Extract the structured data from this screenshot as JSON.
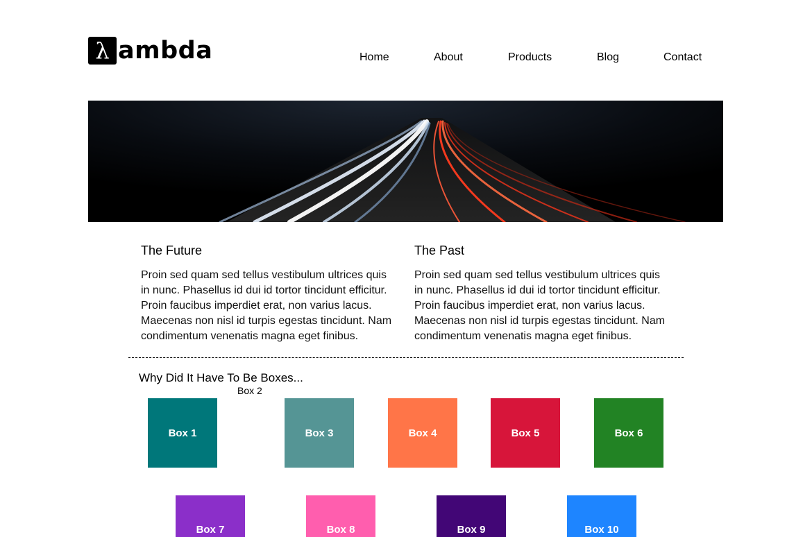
{
  "logo": {
    "mark": "λ",
    "text": "ambda"
  },
  "nav": {
    "items": [
      {
        "label": "Home"
      },
      {
        "label": "About"
      },
      {
        "label": "Products"
      },
      {
        "label": "Blog"
      },
      {
        "label": "Contact"
      }
    ]
  },
  "sections": [
    {
      "title": "The Future",
      "body": "Proin sed quam sed tellus vestibulum ultrices quis in nunc. Phasellus id dui id tortor tincidunt efficitur. Proin faucibus imperdiet erat, non varius lacus. Maecenas non nisl id turpis egestas tincidunt. Nam condimentum venenatis magna eget finibus."
    },
    {
      "title": "The Past",
      "body": "Proin sed quam sed tellus vestibulum ultrices quis in nunc. Phasellus id dui id tortor tincidunt efficitur. Proin faucibus imperdiet erat, non varius lacus. Maecenas non nisl id turpis egestas tincidunt. Nam condimentum venenatis magna eget finibus."
    }
  ],
  "boxes_title": "Why Did It Have To Be Boxes...",
  "boxes": [
    {
      "label": "Box 1",
      "color": "#00777a"
    },
    {
      "label": "Box 2",
      "color": "#ffffff"
    },
    {
      "label": "Box 3",
      "color": "#559595"
    },
    {
      "label": "Box 4",
      "color": "#ff7548"
    },
    {
      "label": "Box 5",
      "color": "#d7153a"
    },
    {
      "label": "Box 6",
      "color": "#228324"
    },
    {
      "label": "Box 7",
      "color": "#8b2fc9"
    },
    {
      "label": "Box 8",
      "color": "#ff5eae"
    },
    {
      "label": "Box 9",
      "color": "#420676"
    },
    {
      "label": "Box 10",
      "color": "#1e85ff"
    }
  ]
}
